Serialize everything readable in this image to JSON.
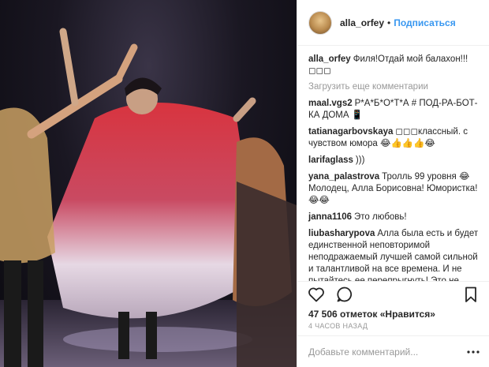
{
  "post": {
    "author": "alla_orfey",
    "separator": "•",
    "follow_label": "Подписаться",
    "load_more_label": "Загрузить еще комментарии",
    "likes": "47 506 отметок «Нравится»",
    "time": "4 ЧАСОВ НАЗАД",
    "add_comment_placeholder": "Добавьте комментарий..."
  },
  "caption": {
    "user": "alla_orfey",
    "text": "Филя!Отдай мой балахон!!! ◻◻◻"
  },
  "comments": [
    {
      "user": "maal.vgs2",
      "text": "Р*А*Б*О*Т*А # ПОД-РА-БОТ-КА ДОМА 📱"
    },
    {
      "user": "tatianagarbovskaya",
      "text": "◻◻◻классный. с чувством юмора 😂👍👍👍😂"
    },
    {
      "user": "larifaglass",
      "text": ")))"
    },
    {
      "user": "yana_palastrova",
      "text": "Тролль 99 уровня 😂 Молодец, Алла Борисовна! Юмористка! 😂😂"
    },
    {
      "user": "janna1106",
      "text": "Это любовь!"
    },
    {
      "user": "liubasharypova",
      "text": "Алла была есть и будет единственной неповторимой неподражаемый лучшей самой сильной и талантливой на все времена. И не пытайтесь ее перепрыгнуть! Это не дано никому! Здоровья и долгих лет жизни"
    }
  ],
  "icons": {
    "like": "heart-icon",
    "comment": "comment-icon",
    "share": "share-icon",
    "save": "bookmark-icon",
    "more": "more-options-icon"
  },
  "colors": {
    "accent": "#3897f0",
    "muted": "#999999",
    "text": "#262626"
  }
}
